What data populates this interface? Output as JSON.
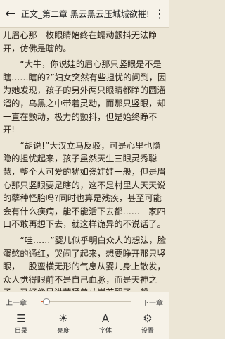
{
  "header": {
    "back_icon": "arrow-left-icon",
    "title": "正文_第二章 黑云黑云压城城欲摧!",
    "more_icon": "more-vertical-icon"
  },
  "content": {
    "paragraphs": [
      {
        "indent": false,
        "text": "儿眉心那一枚眼睛始终在蠕动颤抖无法睁开，仿佛是瞎的。"
      },
      {
        "indent": true,
        "text": "“大牛，你说娃的眉心那只竖眼是不是瞎……瞎的?”妇女突然有些担忧的问到，因为她发现，孩子的另外两只眼睛都睁的圆溜溜的，乌黑之中带着灵动，而那只竖眼，却一直在颤动，极力的颤抖，但是始终睁不开!"
      },
      {
        "indent": true,
        "text": "“胡说!”大汉立马反驳，可是心里也隐隐的担忧起来，孩子虽然天生三眼灵秀聪慧，整个人可爱的犹如瓷娃娃一般，但是眉心那只竖眼要是瞎的，这不是村里人天天说的孽种怪胎吗?同时也算是残疾，甚至可能会有什么疾病，能不能活下去都……一家四口不敢再想下去，就这样诡异的不说话了。"
      },
      {
        "indent": true,
        "text": "“哇……”婴儿似乎明白众人的想法，脸蛋憋的通红，哭闹了起来，想要睁开那只竖眼，一股蛮横无形的气息从婴儿身上散发，众人觉得眼前不是自己血脉，而是天神之子，又好像是洪荒猛兽从崖苏醒了一般。"
      }
    ]
  },
  "reader_controls": {
    "prev_label": "上一章",
    "next_label": "下一章",
    "progress_fraction": 0.06,
    "tools": [
      {
        "icon": "menu-list-icon",
        "label": "目录",
        "glyph": "☰"
      },
      {
        "icon": "brightness-icon",
        "label": "亮度",
        "glyph": "☀"
      },
      {
        "icon": "font-icon",
        "label": "字体",
        "glyph": "A"
      },
      {
        "icon": "settings-gear-icon",
        "label": "设置",
        "glyph": "⚙"
      }
    ]
  },
  "colors": {
    "page_background": "#ece6d6",
    "bar_background": "#f6f2e8",
    "progress_fill": "#e05a2b"
  }
}
